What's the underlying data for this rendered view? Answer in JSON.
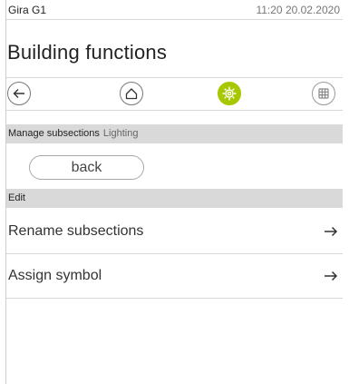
{
  "status": {
    "device": "Gira G1",
    "clock": "11:20 20.02.2020"
  },
  "page": {
    "title": "Building functions"
  },
  "toolbar": {
    "back_icon": "arrow-left-icon",
    "home_icon": "home-icon",
    "settings_icon": "gear-icon",
    "grid_icon": "grid-icon",
    "active": "settings",
    "active_color": "#a7c700"
  },
  "manage": {
    "label": "Manage subsections",
    "sub": "Lighting",
    "back_label": "back"
  },
  "edit": {
    "label": "Edit",
    "items": [
      {
        "label": "Rename subsections",
        "icon": "arrow-right-icon"
      },
      {
        "label": "Assign symbol",
        "icon": "arrow-right-icon"
      }
    ]
  }
}
